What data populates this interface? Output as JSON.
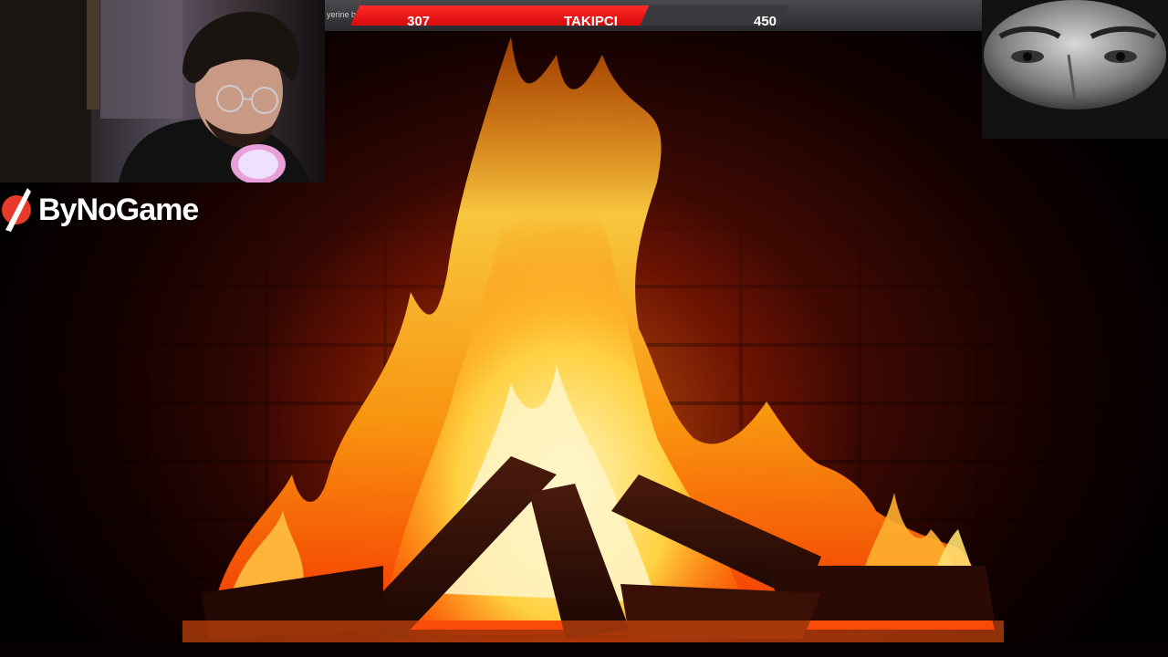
{
  "goal_bar": {
    "ticker_text": "yerine bu",
    "current": "307",
    "label": "TAKIPÇI",
    "target": "450",
    "progress_fraction": 0.682,
    "fill_color": "#e21010"
  },
  "brand": {
    "name": "ByNoGame",
    "icon": "bynogame-logo-icon"
  },
  "webcam": {
    "icon": "streamer-webcam"
  },
  "facecam": {
    "icon": "eyes-closeup-image"
  },
  "colors": {
    "fire_core": "#fff2a0",
    "fire_mid": "#ffb020",
    "fire_outer": "#ff4a00",
    "brick": "#5a1004"
  }
}
